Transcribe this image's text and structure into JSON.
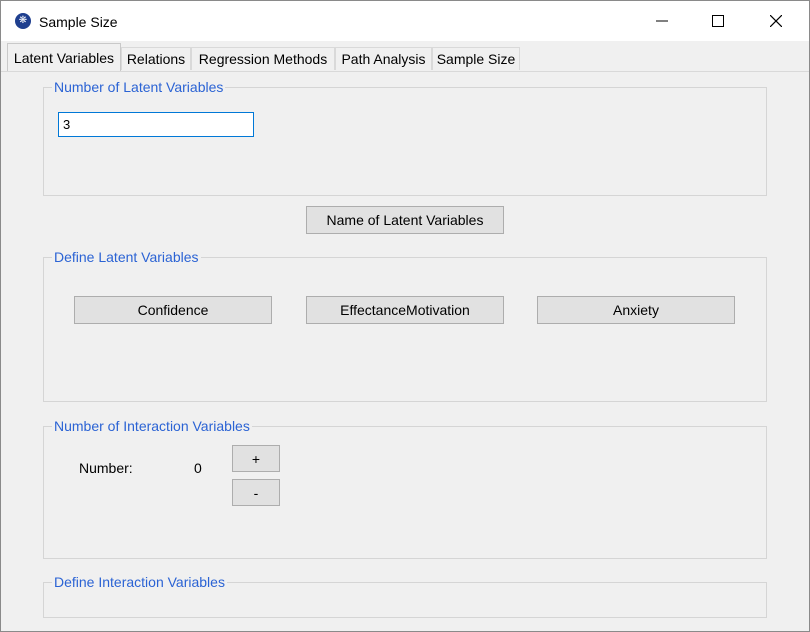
{
  "window": {
    "title": "Sample Size"
  },
  "tabs": [
    {
      "label": "Latent Variables"
    },
    {
      "label": "Relations"
    },
    {
      "label": "Regression Methods"
    },
    {
      "label": "Path Analysis"
    },
    {
      "label": "Sample Size"
    }
  ],
  "active_tab": "Latent Variables",
  "num_latent": {
    "legend": "Number of Latent Variables",
    "value": "3"
  },
  "name_button": "Name of Latent Variables",
  "define_latent": {
    "legend": "Define Latent Variables",
    "buttons": [
      "Confidence",
      "EffectanceMotivation",
      "Anxiety"
    ]
  },
  "interaction": {
    "legend": "Number of Interaction Variables",
    "number_label": "Number:",
    "number_value": "0",
    "plus_label": "+",
    "minus_label": "-"
  },
  "define_interaction": {
    "legend": "Define Interaction Variables"
  },
  "colors": {
    "legend_text": "#2b63d4",
    "input_focus_border": "#0078d7",
    "app_icon": "#1f3f8f"
  }
}
